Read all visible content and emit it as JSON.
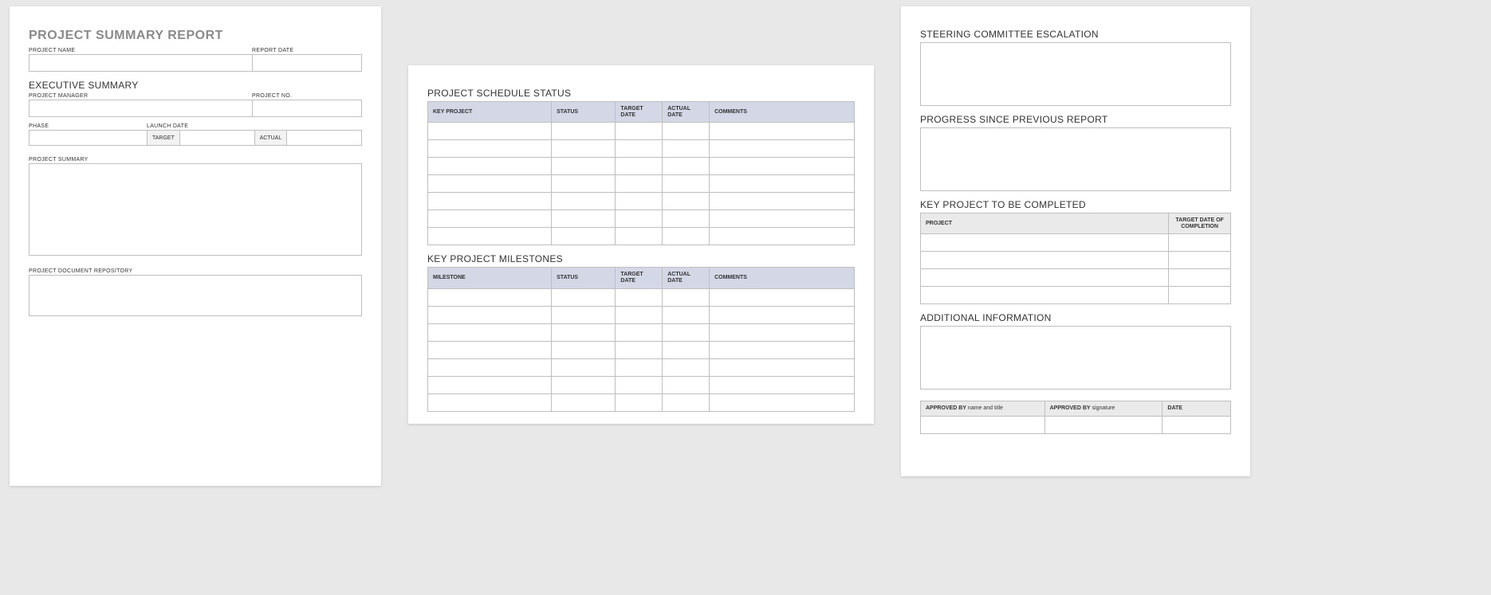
{
  "page1": {
    "title": "PROJECT SUMMARY REPORT",
    "project_name_label": "PROJECT NAME",
    "report_date_label": "REPORT DATE",
    "exec_summary_title": "EXECUTIVE SUMMARY",
    "project_manager_label": "PROJECT MANAGER",
    "project_no_label": "PROJECT NO.",
    "phase_label": "PHASE",
    "launch_date_label": "LAUNCH DATE",
    "target_label": "TARGET",
    "actual_label": "ACTUAL",
    "project_summary_label": "PROJECT SUMMARY",
    "repository_label": "PROJECT DOCUMENT REPOSITORY"
  },
  "page2": {
    "schedule_title": "PROJECT SCHEDULE STATUS",
    "schedule_cols": [
      "KEY PROJECT",
      "STATUS",
      "TARGET DATE",
      "ACTUAL DATE",
      "COMMENTS"
    ],
    "milestones_title": "KEY PROJECT MILESTONES",
    "milestones_cols": [
      "MILESTONE",
      "STATUS",
      "TARGET DATE",
      "ACTUAL DATE",
      "COMMENTS"
    ]
  },
  "page3": {
    "escalation_title": "STEERING COMMITTEE ESCALATION",
    "progress_title": "PROGRESS SINCE PREVIOUS REPORT",
    "kp_title": "KEY PROJECT TO BE COMPLETED",
    "kp_cols": [
      "PROJECT",
      "TARGET DATE OF COMPLETION"
    ],
    "additional_title": "ADDITIONAL INFORMATION",
    "approved_by_label": "APPROVED BY",
    "name_title_sub": "name and title",
    "signature_sub": "signature",
    "date_label": "DATE"
  }
}
